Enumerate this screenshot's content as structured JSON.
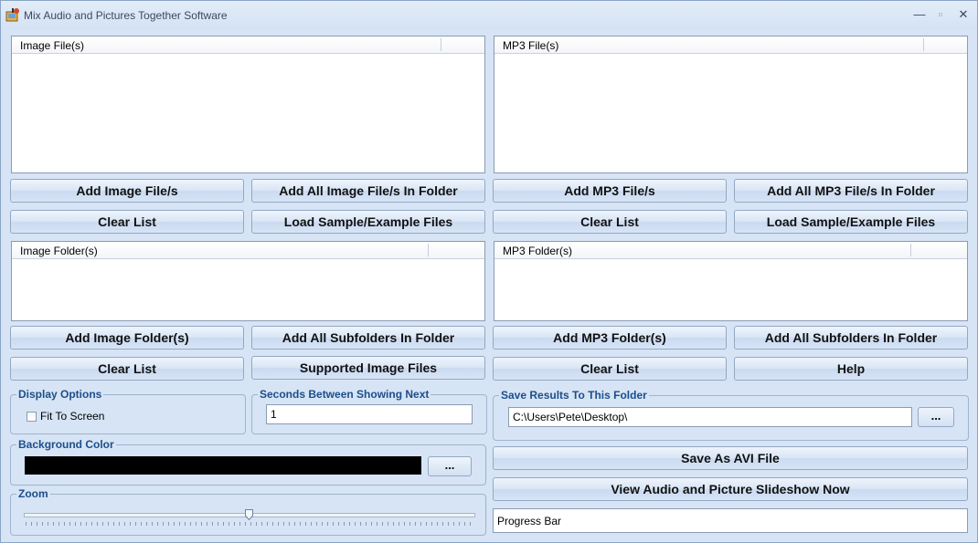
{
  "window": {
    "title": "Mix Audio and Pictures Together Software",
    "min_glyph": "—",
    "max_glyph": "▫",
    "close_glyph": "✕"
  },
  "image_files": {
    "header": "Image File(s)",
    "add_button": "Add Image File/s",
    "add_all_button": "Add All Image File/s In Folder",
    "clear_button": "Clear List",
    "load_sample_button": "Load Sample/Example Files"
  },
  "mp3_files": {
    "header": "MP3 File(s)",
    "add_button": "Add MP3 File/s",
    "add_all_button": "Add All MP3 File/s In Folder",
    "clear_button": "Clear List",
    "load_sample_button": "Load Sample/Example Files"
  },
  "image_folders": {
    "header": "Image Folder(s)",
    "add_button": "Add Image Folder(s)",
    "add_subfolders_button": "Add All Subfolders In Folder",
    "clear_button": "Clear List",
    "supported_button": "Supported Image Files"
  },
  "mp3_folders": {
    "header": "MP3 Folder(s)",
    "add_button": "Add MP3 Folder(s)",
    "add_subfolders_button": "Add All Subfolders In Folder",
    "clear_button": "Clear List",
    "help_button": "Help"
  },
  "display_options": {
    "label": "Display Options",
    "fit_to_screen": "Fit To Screen",
    "fit_checked": false
  },
  "seconds": {
    "label": "Seconds Between Showing Next",
    "value": "1"
  },
  "background": {
    "label": "Background Color",
    "color": "#000000",
    "browse": "..."
  },
  "zoom": {
    "label": "Zoom",
    "position_fraction": 0.5
  },
  "save_results": {
    "label": "Save Results To This Folder",
    "path": "C:\\Users\\Pete\\Desktop\\",
    "browse": "..."
  },
  "actions": {
    "save_avi": "Save As AVI File",
    "view_slideshow": "View Audio and Picture Slideshow Now",
    "progress": "Progress Bar"
  }
}
